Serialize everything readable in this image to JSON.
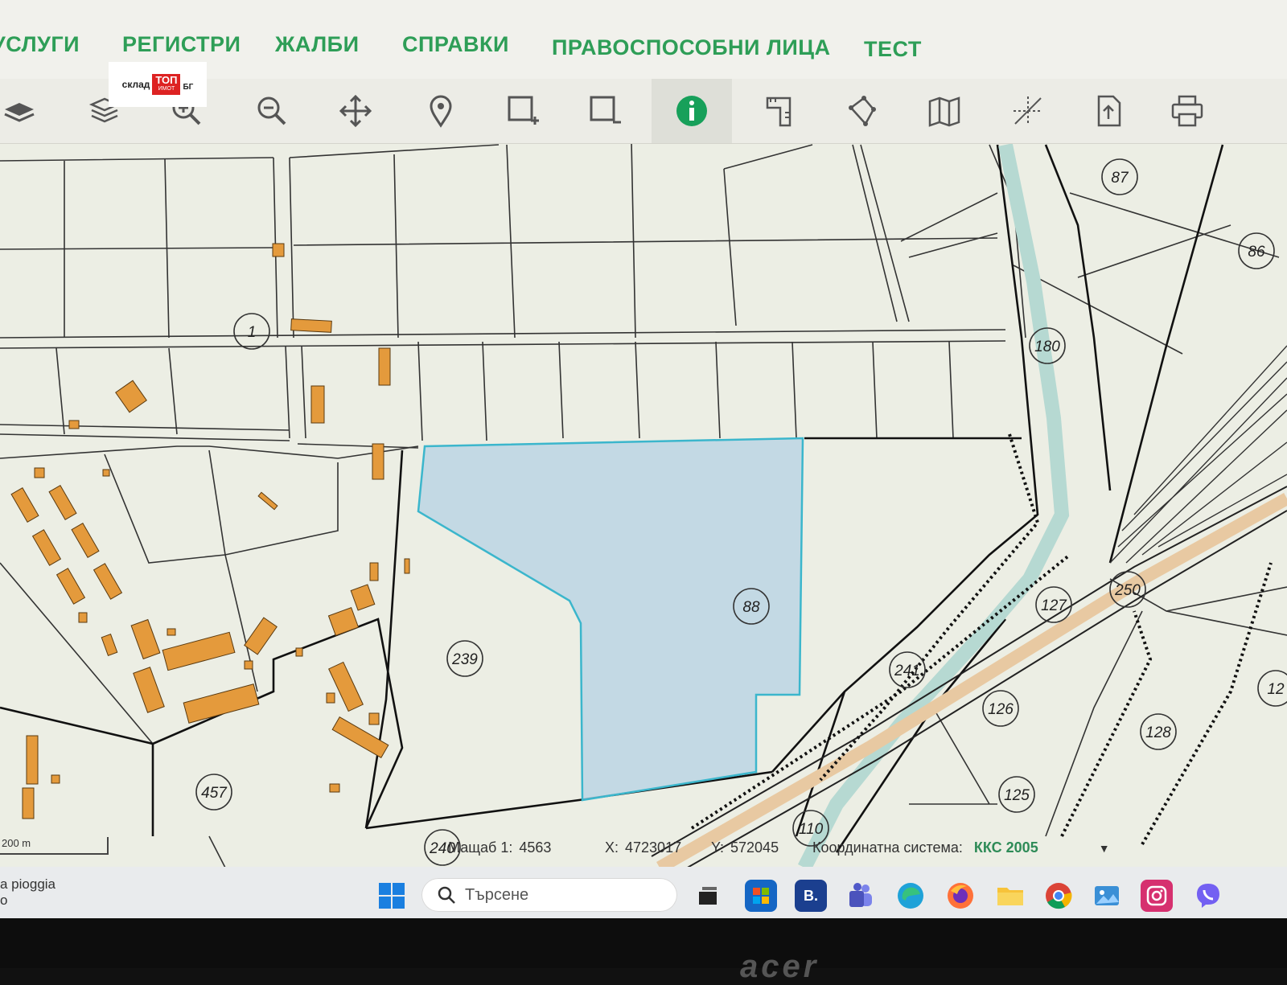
{
  "menu": {
    "items": [
      "УСЛУГИ",
      "РЕГИСТРИ",
      "ЖАЛБИ",
      "СПРАВКИ",
      "ПРАВОСПОСОБНИ ЛИЦА",
      "ТЕСТ"
    ]
  },
  "logo": {
    "left": "склад",
    "middle_top": "ТОП",
    "middle_bottom": "ИМОТ",
    "right": "БГ"
  },
  "toolbar": {
    "tools": [
      "layers-icon",
      "layers-stack-icon",
      "zoom-in-icon",
      "zoom-out-icon",
      "pan-icon",
      "location-pin-icon",
      "add-rectangle-icon",
      "remove-rectangle-icon",
      "info-icon",
      "measure-icon",
      "polygon-icon",
      "map-icon",
      "crosshair-icon",
      "export-icon",
      "print-icon"
    ],
    "active_tool": "info-icon",
    "active_color": "#17a05a"
  },
  "map": {
    "highlight_color": "#8fd3e0",
    "parcel_labels": [
      "87",
      "86",
      "1",
      "180",
      "88",
      "239",
      "127",
      "250",
      "241",
      "126",
      "128",
      "457",
      "125",
      "110",
      "240",
      "12"
    ],
    "scale_bar": "200 m"
  },
  "status": {
    "scale_label": "Мащаб 1:",
    "scale_value": "4563",
    "x_label": "X:",
    "x_value": "4723017",
    "y_label": "Y:",
    "y_value": "572045",
    "cs_label": "Координатна система:",
    "cs_value": "ККС 2005"
  },
  "taskbar": {
    "weather_line1": "a pioggia",
    "weather_line2": "o",
    "search_placeholder": "Търсене",
    "apps": [
      "windows-start-icon",
      "task-view-icon",
      "store-icon",
      "booking-icon",
      "teams-icon",
      "edge-icon",
      "firefox-icon",
      "file-explorer-icon",
      "chrome-icon",
      "photos-icon",
      "instagram-icon",
      "viber-icon"
    ],
    "booking_letter": "B."
  },
  "device": {
    "brand": "acer"
  }
}
